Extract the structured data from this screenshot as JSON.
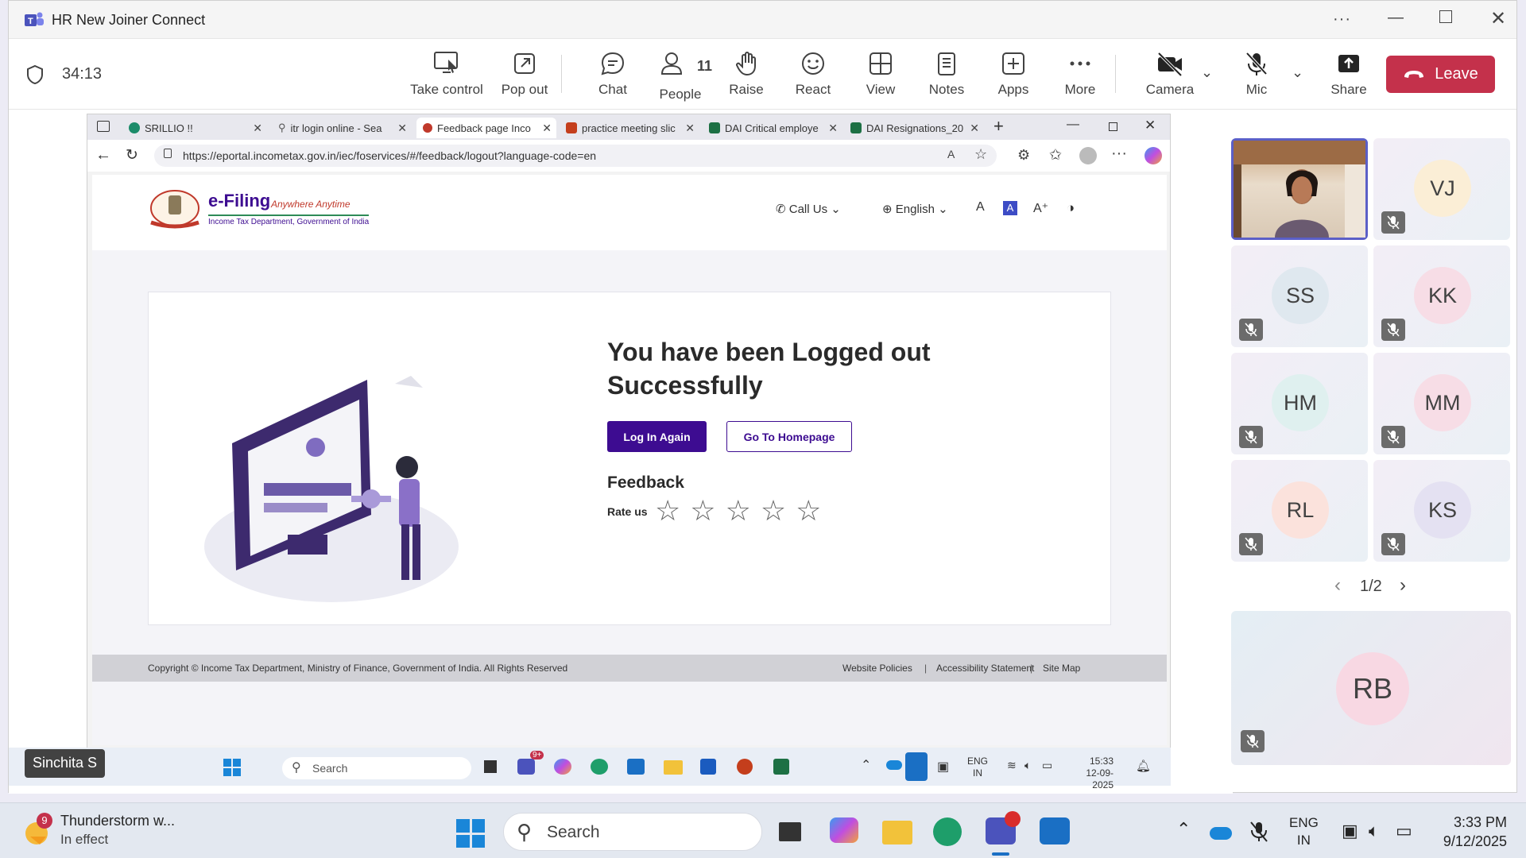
{
  "teams": {
    "window_title": "HR New Joiner Connect",
    "timer": "34:13",
    "toolbar": [
      {
        "label": "Take control",
        "icon": "take-control-icon"
      },
      {
        "label": "Pop out",
        "icon": "pop-out-icon"
      },
      {
        "label": "Chat",
        "icon": "chat-icon"
      },
      {
        "label": "People",
        "icon": "people-icon",
        "count": "11"
      },
      {
        "label": "Raise",
        "icon": "raise-hand-icon"
      },
      {
        "label": "React",
        "icon": "react-icon"
      },
      {
        "label": "View",
        "icon": "view-icon"
      },
      {
        "label": "Notes",
        "icon": "notes-icon"
      },
      {
        "label": "Apps",
        "icon": "apps-icon"
      },
      {
        "label": "More",
        "icon": "more-icon"
      },
      {
        "label": "Camera",
        "icon": "camera-off-icon"
      },
      {
        "label": "Mic",
        "icon": "mic-off-icon"
      },
      {
        "label": "Share",
        "icon": "share-icon"
      }
    ],
    "leave_label": "Leave",
    "presenter_name": "Sinchita S",
    "participants": [
      {
        "initials": "VJ",
        "color": "#fbeed6"
      },
      {
        "initials": "SS",
        "color": "#dfe8ef"
      },
      {
        "initials": "KK",
        "color": "#f7dde6"
      },
      {
        "initials": "HM",
        "color": "#dff0ef"
      },
      {
        "initials": "MM",
        "color": "#f7dde6"
      },
      {
        "initials": "RL",
        "color": "#fbe2dc"
      },
      {
        "initials": "KS",
        "color": "#e4e1f2"
      }
    ],
    "pager": "1/2",
    "large_participant": {
      "initials": "RB",
      "color": "#f8d8e3"
    }
  },
  "browser": {
    "tabs": [
      {
        "title": "SRILLIO !!",
        "active": false
      },
      {
        "title": "itr login online - Sea",
        "active": false
      },
      {
        "title": "Feedback page Inco",
        "active": true
      },
      {
        "title": "practice meeting slic",
        "active": false
      },
      {
        "title": "DAI Critical employe",
        "active": false
      },
      {
        "title": "DAI Resignations_20",
        "active": false
      }
    ],
    "url": "https://eportal.incometax.gov.in/iec/foservices/#/feedback/logout?language-code=en"
  },
  "portal": {
    "logo_title": "e-Filing",
    "logo_tagline": "Anywhere Anytime",
    "logo_subtitle": "Income Tax Department, Government of India",
    "call_us": "Call Us",
    "language": "English",
    "heading_line1": "You have been Logged out",
    "heading_line2": "Successfully",
    "login_again": "Log In Again",
    "go_home": "Go To Homepage",
    "feedback_title": "Feedback",
    "rate_label": "Rate us",
    "stars": 5,
    "copyright": "Copyright © Income Tax Department, Ministry of Finance, Government of India. All Rights Reserved",
    "footer_links": [
      "Website Policies",
      "Accessibility Statement",
      "Site Map"
    ]
  },
  "inner_taskbar": {
    "search": "Search",
    "lang_top": "ENG",
    "lang_bottom": "IN",
    "time": "15:33",
    "date": "12-09-2025",
    "badge": "9+"
  },
  "taskbar": {
    "weather_badge": "9",
    "weather_title": "Thunderstorm w...",
    "weather_sub": "In effect",
    "search": "Search",
    "lang_top": "ENG",
    "lang_bottom": "IN",
    "time": "3:33 PM",
    "date": "9/12/2025"
  }
}
